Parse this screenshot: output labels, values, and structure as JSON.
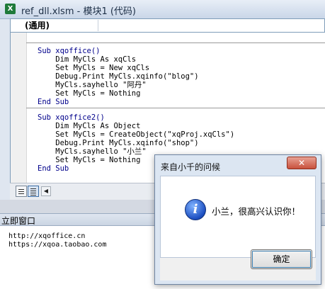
{
  "window": {
    "title": "ref_dll.xlsm - 模块1 (代码)",
    "app_icon_glyph": "X",
    "object_combo": "(通用)"
  },
  "code": {
    "sub1": {
      "header": "Sub xqoffice()",
      "lines": [
        "    Dim MyCls As xqCls",
        "    Set MyCls = New xqCls",
        "    Debug.Print MyCls.xqinfo(\"blog\")",
        "    MyCls.sayhello \"阿丹\"",
        "    Set MyCls = Nothing"
      ],
      "footer": "End Sub"
    },
    "sub2": {
      "header": "Sub xqoffice2()",
      "lines": [
        "    Dim MyCls As Object",
        "    Set MyCls = CreateObject(\"xqProj.xqCls\")",
        "    Debug.Print MyCls.xqinfo(\"shop\")",
        "    MyCls.sayhello \"小兰\"",
        "    Set MyCls = Nothing"
      ],
      "footer": "End Sub"
    }
  },
  "immediate": {
    "title": "立即窗口",
    "lines": [
      "http://xqoffice.cn",
      "https://xqoa.taobao.com"
    ]
  },
  "dialog": {
    "title": "来自小千的问候",
    "message": "小兰，很高兴认识你！",
    "ok_label": "确定",
    "close_glyph": "✕",
    "icon": "info-icon",
    "icon_glyph": "i"
  },
  "colors": {
    "keyword": "#00008b",
    "close_button": "#c8523d",
    "info_icon": "#1d4fc1"
  }
}
